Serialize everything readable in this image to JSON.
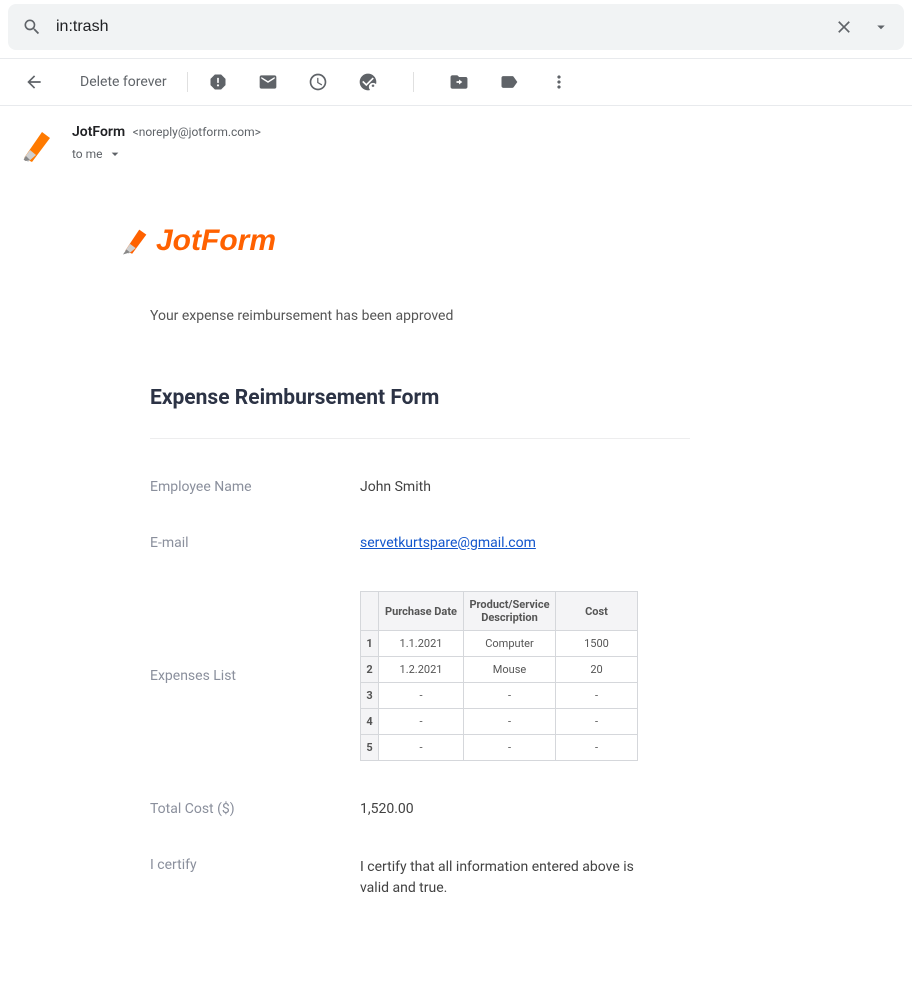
{
  "search": {
    "value": "in:trash"
  },
  "toolbar": {
    "delete_forever": "Delete forever"
  },
  "sender": {
    "name": "JotForm",
    "email": "<noreply@jotform.com>",
    "to": "to me"
  },
  "body": {
    "logo_text": "JotForm",
    "approval_msg": "Your expense reimbursement has been approved",
    "form_title": "Expense Reimbursement Form",
    "labels": {
      "employee_name": "Employee Name",
      "email": "E-mail",
      "expenses_list": "Expenses List",
      "total_cost": "Total Cost ($)",
      "certify": "I certify"
    },
    "values": {
      "employee_name": "John Smith",
      "email": "servetkurtspare@gmail.com",
      "total_cost": "1,520.00",
      "certify": "I certify that all information entered above is valid and true."
    },
    "table": {
      "headers": {
        "date": "Purchase Date",
        "desc": "Product/Service Description",
        "cost": "Cost"
      },
      "rows": [
        {
          "n": "1",
          "date": "1.1.2021",
          "desc": "Computer",
          "cost": "1500"
        },
        {
          "n": "2",
          "date": "1.2.2021",
          "desc": "Mouse",
          "cost": "20"
        },
        {
          "n": "3",
          "date": "-",
          "desc": "-",
          "cost": "-"
        },
        {
          "n": "4",
          "date": "-",
          "desc": "-",
          "cost": "-"
        },
        {
          "n": "5",
          "date": "-",
          "desc": "-",
          "cost": "-"
        }
      ]
    }
  }
}
